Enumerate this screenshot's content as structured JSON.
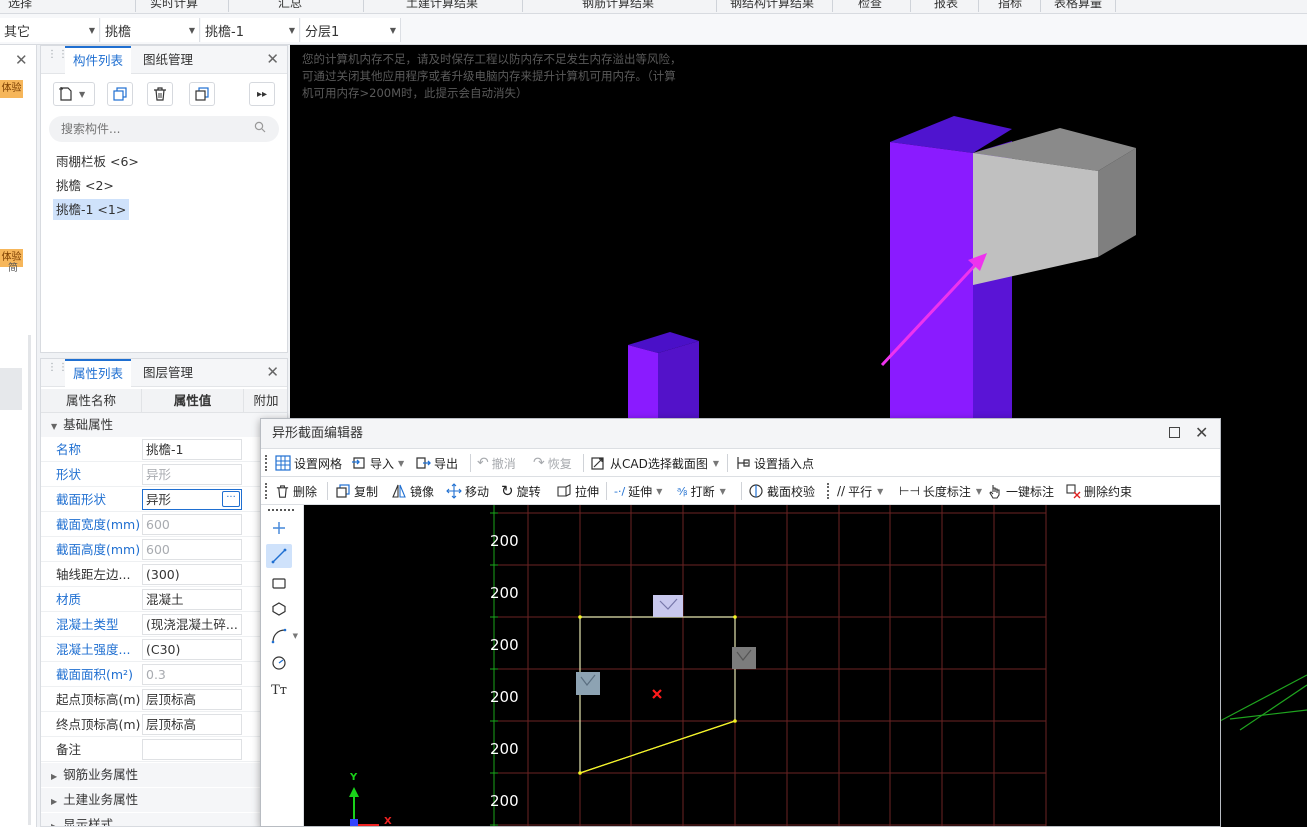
{
  "top_menu": [
    "选择",
    "实时计算",
    "汇总",
    "土建计算结果",
    "钢筋计算结果",
    "钢结构计算结果",
    "检查",
    "报表",
    "指标",
    "表格算量"
  ],
  "filters": {
    "category": "其它",
    "type": "挑檐",
    "component": "挑檐-1",
    "layer": "分层1"
  },
  "left_strip": {
    "badge1": "体验",
    "badge2": "体验",
    "badge2_icon": "简"
  },
  "component_panel": {
    "tab_active": "构件列表",
    "tab_other": "图纸管理",
    "search_placeholder": "搜索构件...",
    "items": [
      {
        "label": "雨棚栏板 <6>",
        "selected": false
      },
      {
        "label": "挑檐 <2>",
        "selected": false
      },
      {
        "label": "挑檐-1 <1>",
        "selected": true
      }
    ]
  },
  "property_panel": {
    "tab_active": "属性列表",
    "tab_other": "图层管理",
    "col_name": "属性名称",
    "col_value": "属性值",
    "col_extra": "附加",
    "group_basic": "基础属性",
    "rows": [
      {
        "name": "名称",
        "value": "挑檐-1",
        "name_blue": true,
        "value_gray": false
      },
      {
        "name": "形状",
        "value": "异形",
        "name_blue": true,
        "value_gray": true
      },
      {
        "name": "截面形状",
        "value": "异形",
        "name_blue": true,
        "value_gray": false
      },
      {
        "name": "截面宽度(mm)",
        "value": "600",
        "name_blue": true,
        "value_gray": true
      },
      {
        "name": "截面高度(mm)",
        "value": "600",
        "name_blue": true,
        "value_gray": true
      },
      {
        "name": "轴线距左边...",
        "value": "(300)",
        "name_blue": false,
        "value_gray": false
      },
      {
        "name": "材质",
        "value": "混凝土",
        "name_blue": true,
        "value_gray": false
      },
      {
        "name": "混凝土类型",
        "value": "(现浇混凝土碎...",
        "name_blue": true,
        "value_gray": false
      },
      {
        "name": "混凝土强度...",
        "value": "(C30)",
        "name_blue": true,
        "value_gray": false
      },
      {
        "name": "截面面积(m²)",
        "value": "0.3",
        "name_blue": true,
        "value_gray": true
      },
      {
        "name": "起点顶标高(m)",
        "value": "层顶标高",
        "name_blue": false,
        "value_gray": false
      },
      {
        "name": "终点顶标高(m)",
        "value": "层顶标高",
        "name_blue": false,
        "value_gray": false
      },
      {
        "name": "备注",
        "value": "",
        "name_blue": false,
        "value_gray": false
      }
    ],
    "group_rebar": "钢筋业务属性",
    "group_civil": "土建业务属性",
    "group_display": "显示样式"
  },
  "view3d": {
    "warning": "您的计算机内存不足，请及时保存工程以防内存不足发生内存溢出等风险，可通过关闭其他应用程序或者升级电脑内存来提升计算机可用内存。（计算机可用内存>200M时，此提示会自动消失）"
  },
  "editor": {
    "title": "异形截面编辑器",
    "toolbar1": {
      "set_grid": "设置网格",
      "import": "导入",
      "export": "导出",
      "undo": "撤消",
      "redo": "恢复",
      "from_cad": "从CAD选择截面图",
      "set_insert": "设置插入点"
    },
    "toolbar2": {
      "delete": "删除",
      "copy": "复制",
      "mirror": "镜像",
      "move": "移动",
      "rotate": "旋转",
      "stretch": "拉伸",
      "extend": "延伸",
      "break": "打断",
      "section_check": "截面校验",
      "parallel": "平行",
      "length_dim": "长度标注",
      "one_key_dim": "一键标注",
      "delete_constraint": "删除约束"
    },
    "grid_labels": [
      "200",
      "200",
      "200",
      "200",
      "200",
      "200"
    ],
    "axis": {
      "y": "Y",
      "x": "X"
    }
  }
}
